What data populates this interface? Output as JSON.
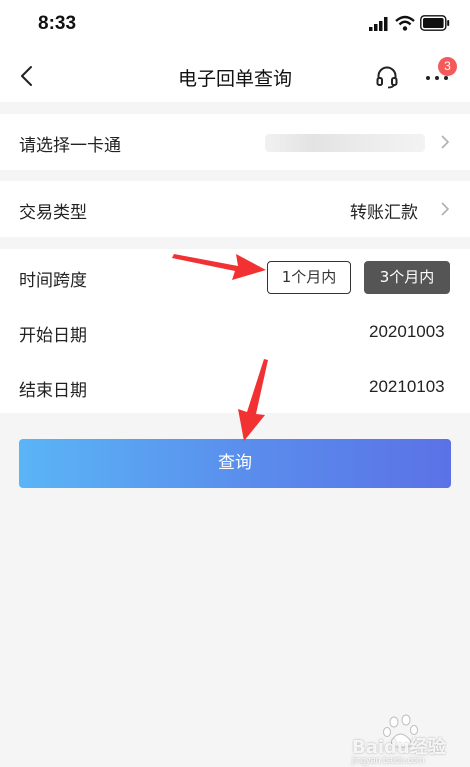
{
  "status": {
    "time": "8:33"
  },
  "nav": {
    "title": "电子回单查询",
    "badge_count": "3"
  },
  "card_row": {
    "label": "请选择一卡通"
  },
  "type_row": {
    "label": "交易类型",
    "value": "转账汇款"
  },
  "span_row": {
    "label": "时间跨度",
    "options": [
      "1个月内",
      "3个月内"
    ],
    "selected": "3个月内"
  },
  "start_row": {
    "label": "开始日期",
    "value": "20201003"
  },
  "end_row": {
    "label": "结束日期",
    "value": "20210103"
  },
  "query_button": {
    "label": "查询"
  },
  "watermark": {
    "text": "Baidu经验",
    "url": "jingyan.baidu.com"
  },
  "colors": {
    "button_gradient_start": "#5ab5f6",
    "button_gradient_end": "#5b72e6",
    "badge": "#f45a5a",
    "annotation_arrow": "#f23232",
    "selected_pill": "#555555"
  },
  "icons": [
    "signal-icon",
    "wifi-icon",
    "battery-icon",
    "back-arrow-icon",
    "headset-icon",
    "more-icon",
    "chevron-right-icon"
  ]
}
